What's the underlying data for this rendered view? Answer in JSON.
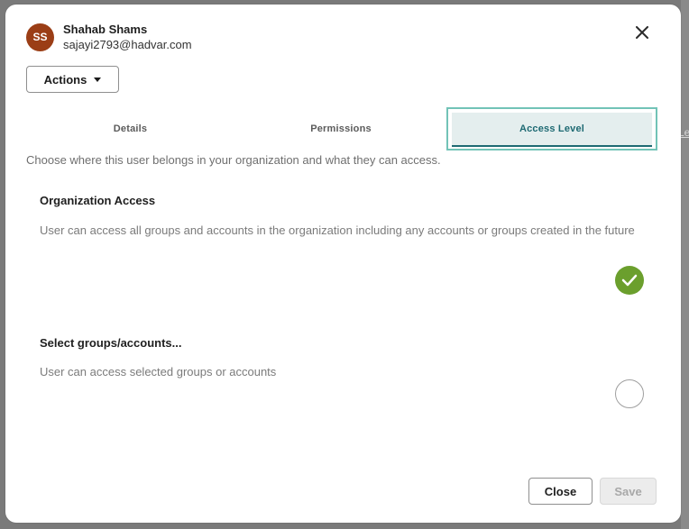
{
  "user": {
    "initials": "SS",
    "name": "Shahab Shams",
    "email": "sajayi2793@hadvar.com"
  },
  "actions": {
    "label": "Actions"
  },
  "tabs": [
    {
      "label": "Details"
    },
    {
      "label": "Permissions"
    },
    {
      "label": "Access Level"
    }
  ],
  "subtitle": "Choose where this user belongs in your organization and what they can access.",
  "sections": {
    "organization": {
      "title": "Organization Access",
      "description": "User can access all groups and accounts in the organization including any accounts or groups created in the future",
      "selected": true
    },
    "select_groups": {
      "title": "Select groups/accounts...",
      "description": "User can access selected groups or accounts",
      "selected": false
    }
  },
  "footer": {
    "close_label": "Close",
    "save_label": "Save"
  },
  "colors": {
    "avatar_bg": "#9b3e16",
    "active_tab_border": "#72c3b7",
    "active_tab_text": "#1e6a73",
    "selected_green": "#6b9f2d"
  },
  "icons": {
    "close": "close-icon",
    "dropdown": "chevron-down-icon",
    "check": "check-icon"
  },
  "background": {
    "tab_fragment": "Le"
  }
}
